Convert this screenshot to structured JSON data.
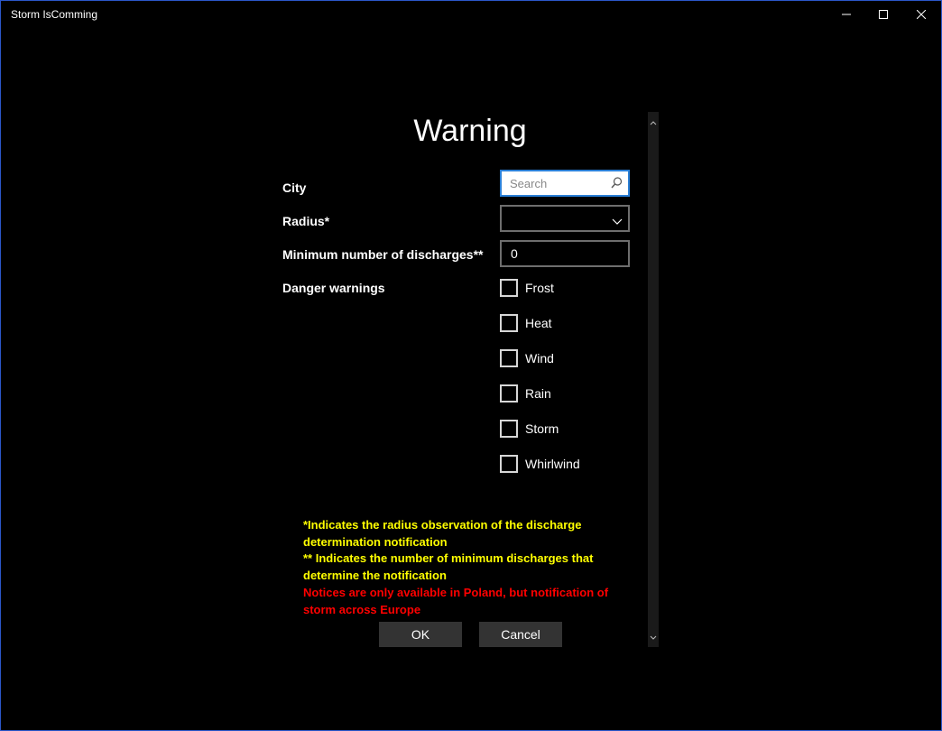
{
  "window": {
    "title": "Storm IsComming"
  },
  "form": {
    "heading": "Warning",
    "city_label": "City",
    "city_placeholder": "Search",
    "radius_label": "Radius*",
    "radius_value": "",
    "min_discharges_label": "Minimum number of discharges**",
    "min_discharges_value": "0",
    "danger_label": "Danger warnings",
    "danger_options": [
      {
        "label": "Frost",
        "checked": false
      },
      {
        "label": "Heat",
        "checked": false
      },
      {
        "label": "Wind",
        "checked": false
      },
      {
        "label": "Rain",
        "checked": false
      },
      {
        "label": "Storm",
        "checked": false
      },
      {
        "label": "Whirlwind",
        "checked": false
      }
    ]
  },
  "notes": {
    "line1a": "*Indicates the radius observation of the discharge",
    "line1b": "determination notification",
    "line2a": "** Indicates the number of minimum discharges that",
    "line2b": "determine the notification",
    "line3a": "Notices are only available in Poland, but notification of",
    "line3b": "storm across Europe"
  },
  "buttons": {
    "ok": "OK",
    "cancel": "Cancel"
  },
  "colors": {
    "background": "#000000",
    "accent": "#2a7fd6",
    "note_yellow": "#ffff00",
    "note_red": "#ff0000"
  }
}
